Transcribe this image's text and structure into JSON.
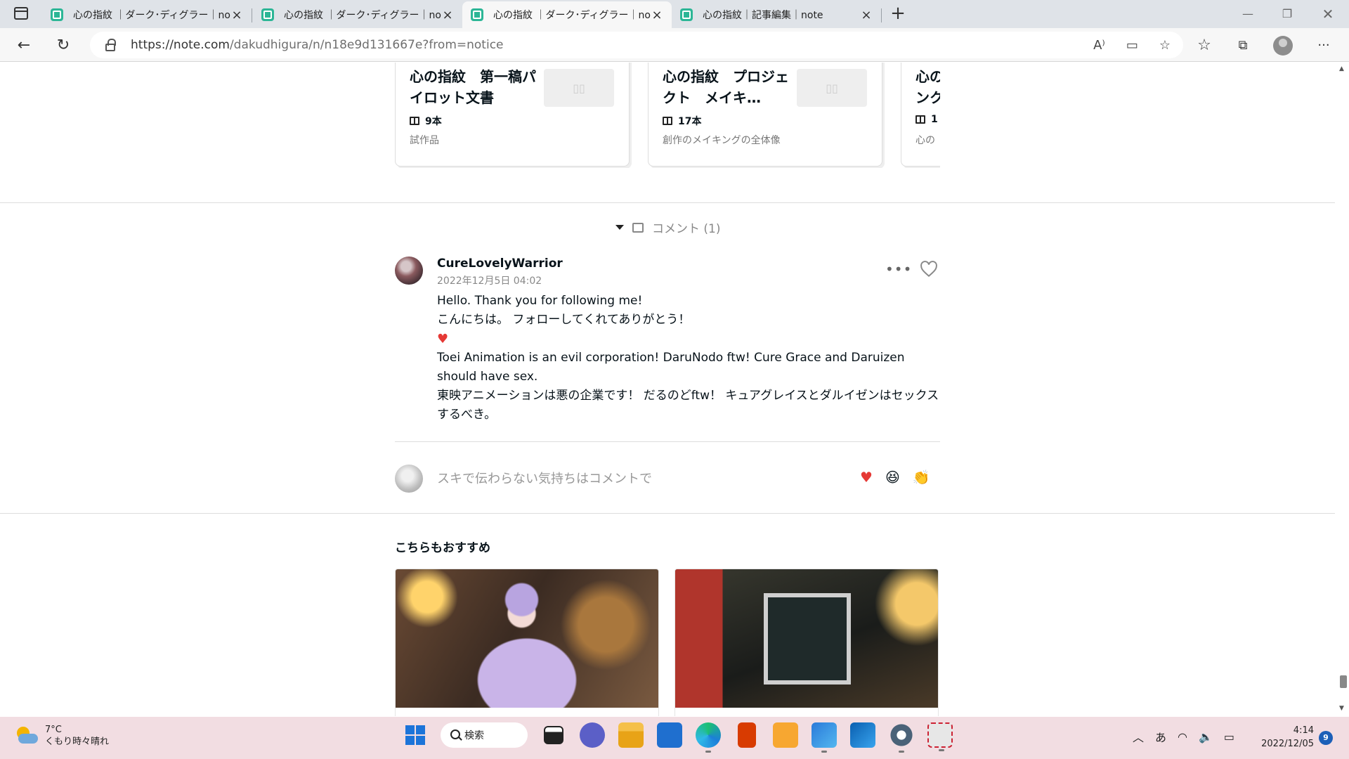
{
  "browser": {
    "tabs": [
      {
        "title": "心の指紋 ｜ダーク･ディグラー｜note"
      },
      {
        "title": "心の指紋 ｜ダーク･ディグラー｜note"
      },
      {
        "title": "心の指紋 ｜ダーク･ディグラー｜note"
      },
      {
        "title": "心の指紋｜記事編集｜note"
      }
    ],
    "url_host": "https://note.com",
    "url_path": "/dakudhigura/n/n18e9d131667e?from=notice"
  },
  "magazines": [
    {
      "title": "心の指紋　第一稿パイロット文書",
      "count": "9本",
      "desc": "試作品"
    },
    {
      "title": "心の指紋　プロジェクト　メイキ…",
      "count": "17本",
      "desc": "創作のメイキングの全体像"
    },
    {
      "title": "心のンク",
      "count": "1",
      "desc": "心の"
    }
  ],
  "comments": {
    "toggle_label": "コメント (1)",
    "items": [
      {
        "author": "CureLovelyWarrior",
        "date": "2022年12月5日 04:02",
        "lines": [
          "Hello. Thank you for following me!",
          "こんにちは。 フォローしてくれてありがとう！",
          "♥",
          "Toei Animation is an evil corporation! DaruNodo ftw! Cure Grace and Daruizen should have sex.",
          "東映アニメーションは悪の企業です！ だるのどftw！ キュアグレイスとダルイゼンはセックスするべき。"
        ]
      }
    ],
    "input_placeholder": "スキで伝わらない気持ちはコメントで",
    "reactions": [
      "♥",
      "😆",
      "👏"
    ]
  },
  "recommend": {
    "title": "こちらもおすすめ"
  },
  "taskbar": {
    "temp": "7°C",
    "condition": "くもり時々晴れ",
    "search_label": "検索",
    "ime": "あ",
    "time": "4:14",
    "date": "2022/12/05",
    "notifications": "9"
  },
  "colors": {
    "note_green": "#2cb696",
    "heart_red": "#e53935",
    "taskbar_bg": "#f2dde2"
  }
}
